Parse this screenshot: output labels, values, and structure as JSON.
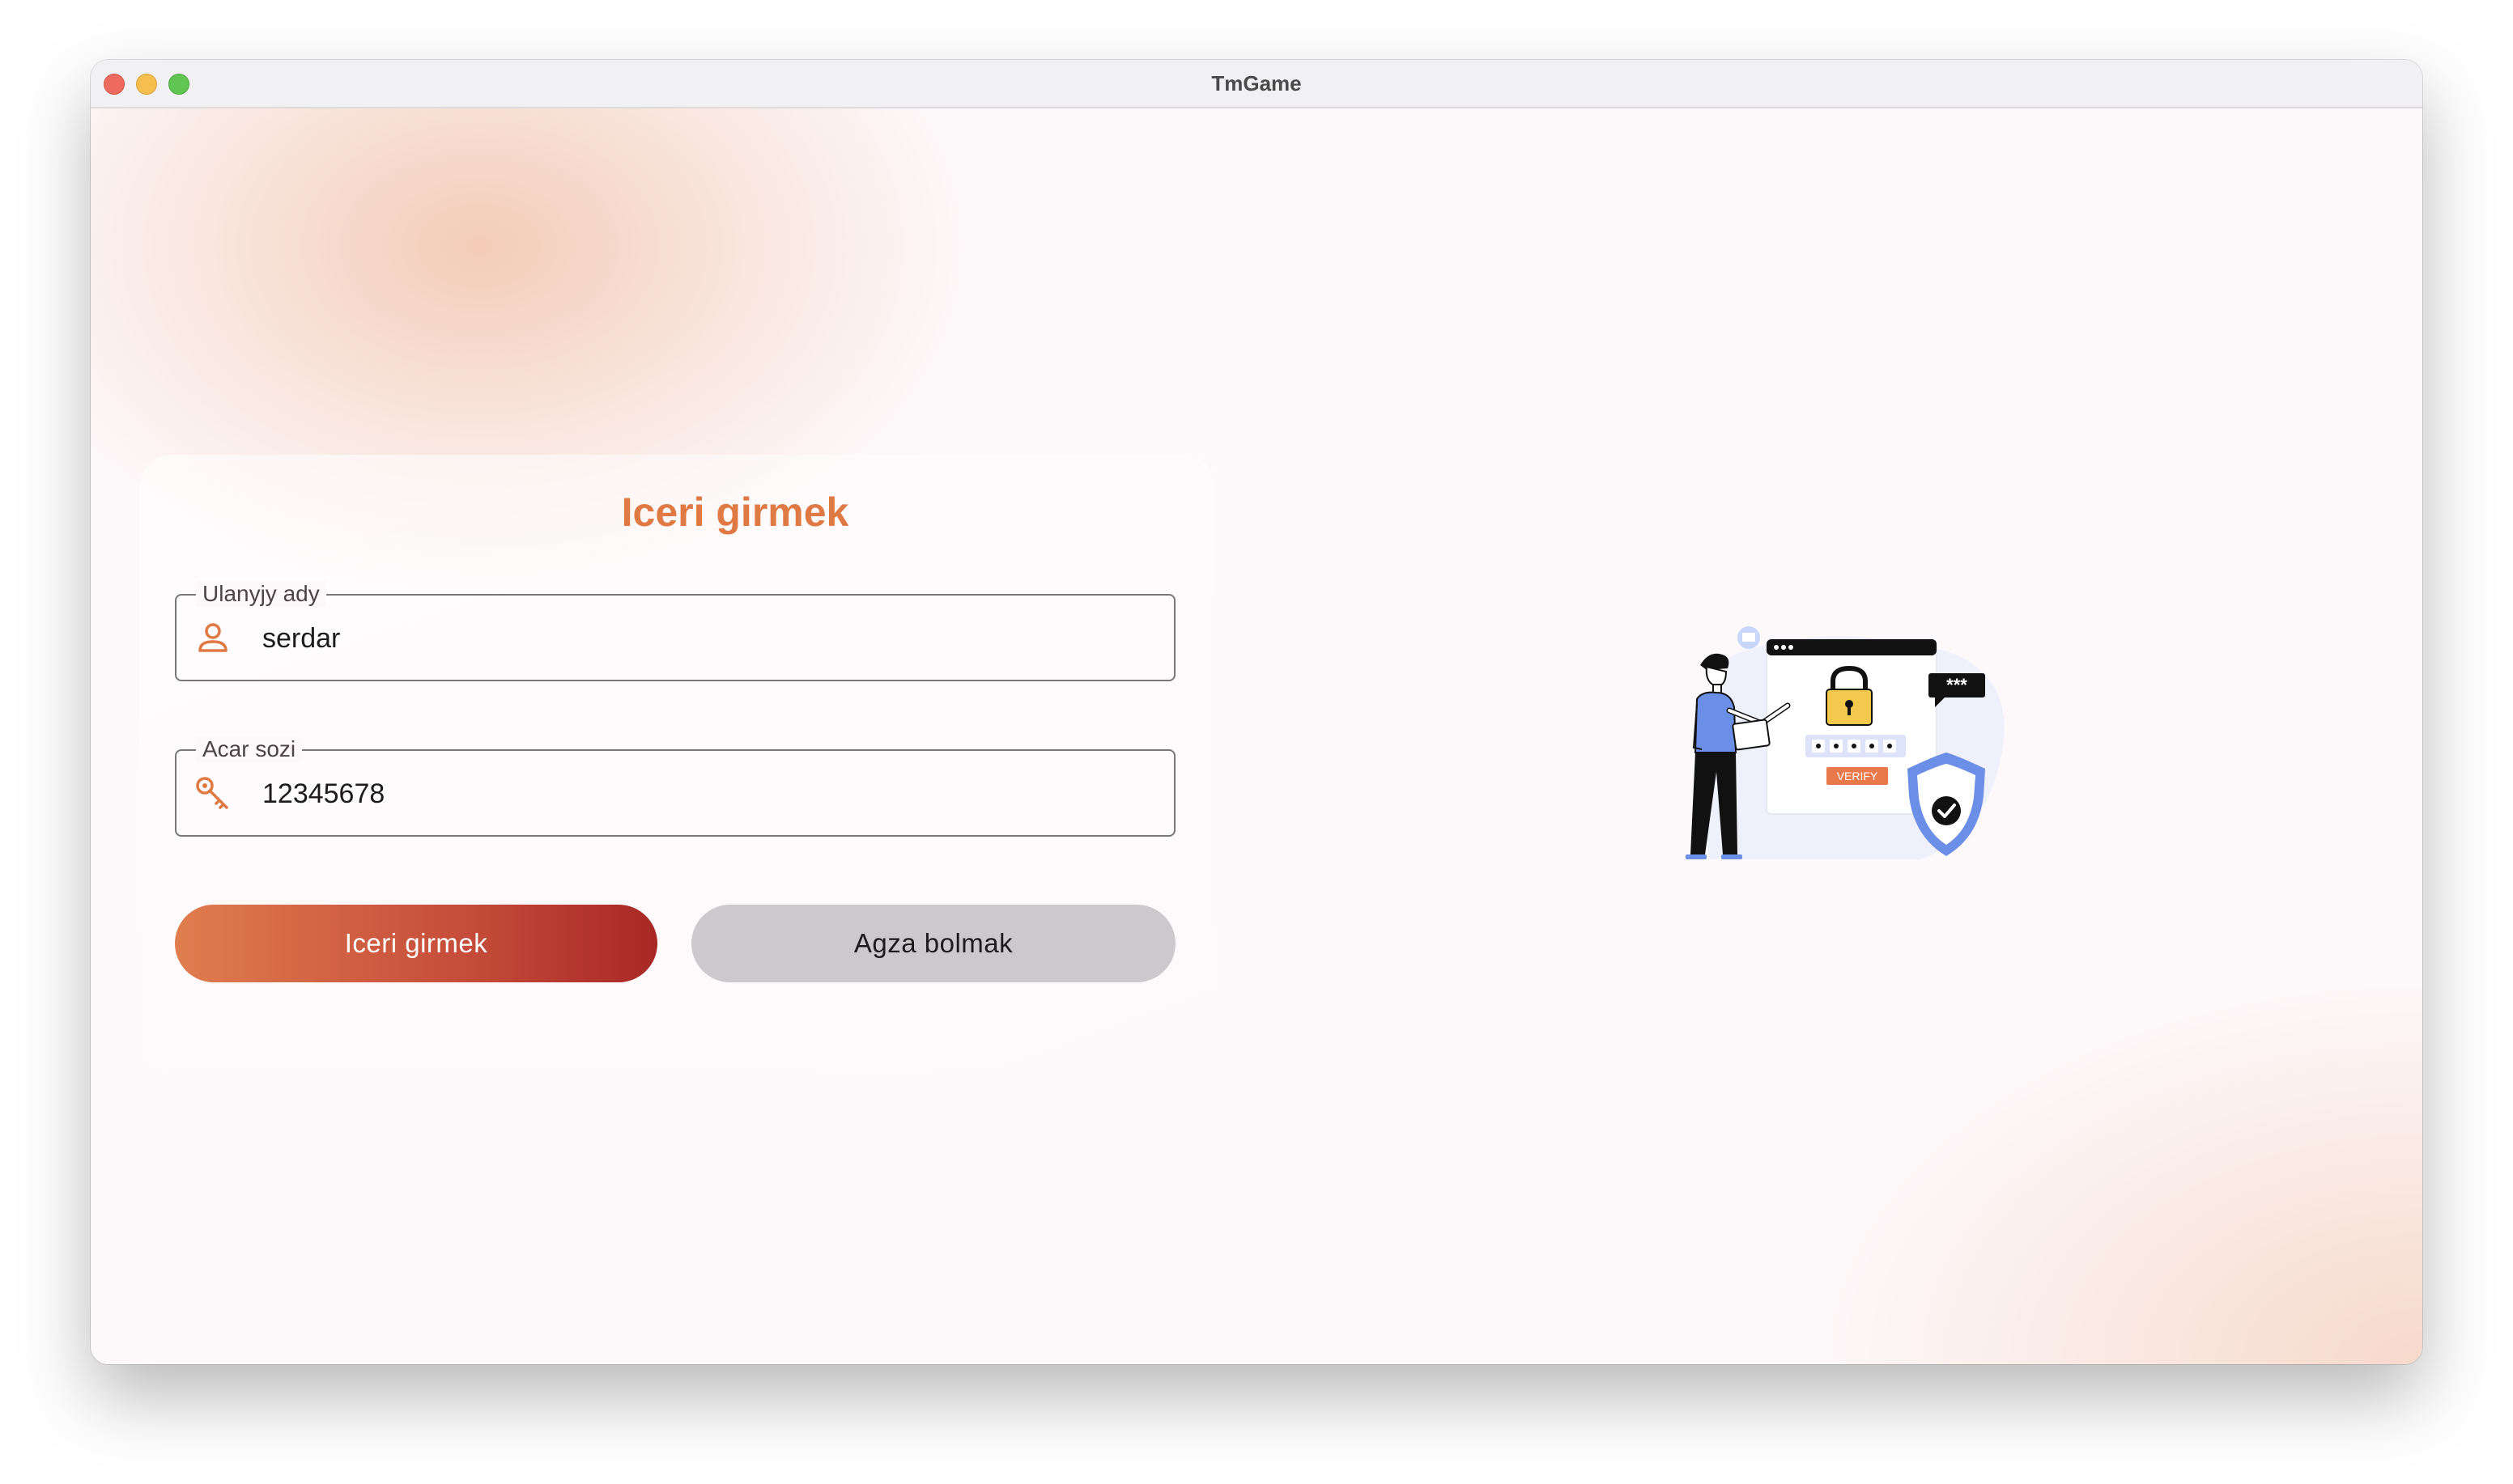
{
  "window": {
    "title": "TmGame"
  },
  "login": {
    "title": "Iceri girmek",
    "username": {
      "label": "Ulanyjy ady",
      "value": "serdar",
      "icon": "person-icon"
    },
    "password": {
      "label": "Acar sozi",
      "value": "12345678",
      "icon": "key-icon"
    },
    "login_button": "Iceri girmek",
    "register_button": "Agza bolmak"
  },
  "illustration": {
    "verify_label": "VERIFY",
    "password_stars": "***"
  },
  "colors": {
    "accent": "#e07a45",
    "button_gradient_start": "#e07d4e",
    "button_gradient_end": "#a82825",
    "secondary_button": "#cbc9cc",
    "shield_blue": "#6b8fe6",
    "lock_yellow": "#f2c94c"
  }
}
